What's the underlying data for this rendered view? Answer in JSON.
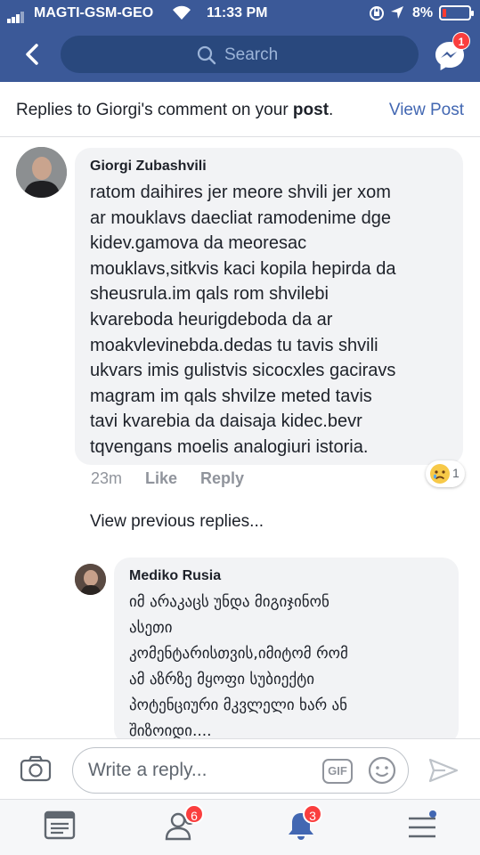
{
  "status_bar": {
    "carrier": "MAGTI-GSM-GEO",
    "time": "11:33 PM",
    "battery": "8%"
  },
  "nav": {
    "search_placeholder": "Search",
    "messenger_badge": "1"
  },
  "header": {
    "text_prefix": "Replies to Giorgi's comment on your ",
    "text_bold": "post",
    "text_suffix": ".",
    "view_post": "View Post"
  },
  "comments": [
    {
      "author": "Giorgi Zubashvili",
      "body": "ratom daihires jer meore shvili jer xom\nar mouklavs daecliat ramodenime dge\nkidev.gamova da meoresac\nmouklavs,sitkvis kaci kopila hepirda da\nsheusrula.im qals rom shvilebi\nkvareboda heurigdeboda da ar\nmoakvlevinebda.dedas tu tavis shvili\nukvars imis gulistvis sicocxles gaciravs\nmagram im qals shvilze meted tavis\ntavi kvarebia da daisaja kidec.bevr\ntqvengans  moelis analogiuri istoria.",
      "time": "23m",
      "like": "Like",
      "reply": "Reply",
      "reaction_count": "1"
    },
    {
      "author": "Mediko Rusia",
      "body": "იმ არაკაცს უნდა მიგიჯინონ\nასეთი\nკომენტარისთვის,იმიტომ რომ\nამ აზრზე მყოფი სუბიექტი\nპოტენციური მკვლელი ხარ ან\nშიზოიდი...."
    }
  ],
  "view_previous": "View previous replies...",
  "reply_bar": {
    "placeholder": "Write a reply...",
    "gif_label": "GIF"
  },
  "tabs": {
    "friends_badge": "6",
    "notifications_badge": "3"
  },
  "colors": {
    "brand": "#3b5998",
    "link": "#4267b2",
    "badge": "#fa3e3e"
  }
}
